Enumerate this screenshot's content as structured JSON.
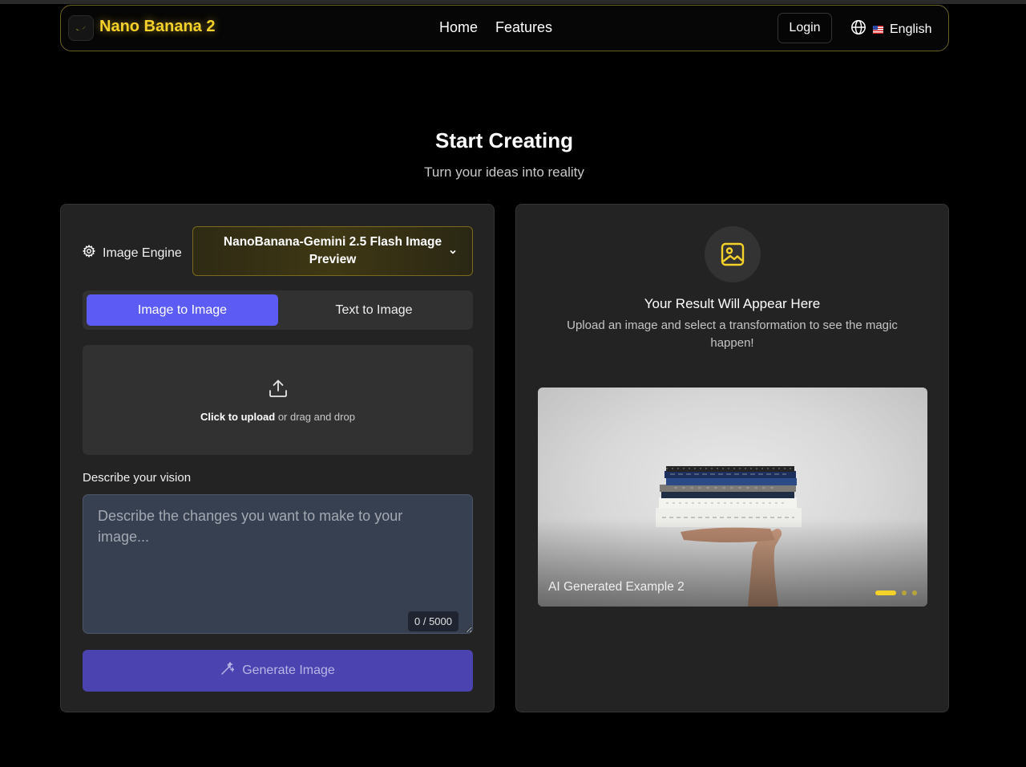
{
  "nav": {
    "brand": "Nano Banana 2",
    "links": [
      "Home",
      "Features"
    ],
    "login": "Login",
    "language": "English"
  },
  "hero": {
    "title": "Start Creating",
    "subtitle": "Turn your ideas into reality"
  },
  "editor": {
    "engine_label": "Image Engine",
    "engine_value": "NanoBanana-Gemini 2.5 Flash Image Preview",
    "tabs": [
      "Image to Image",
      "Text to Image"
    ],
    "active_tab": "Image to Image",
    "upload_strong": "Click to upload",
    "upload_rest": "or drag and drop",
    "vision_label": "Describe your vision",
    "vision_placeholder": "Describe the changes you want to make to your image...",
    "vision_value": "",
    "counter": "0 / 5000",
    "generate": "Generate Image"
  },
  "result": {
    "title": "Your Result Will Appear Here",
    "description": "Upload an image and select a transformation to see the magic happen!",
    "carousel_caption": "AI Generated Example 2",
    "carousel_slides": 3,
    "carousel_active": 1
  },
  "colors": {
    "brand_yellow": "#f5d22a",
    "accent_purple": "#5c5cf5",
    "generate_purple": "#4b44b0",
    "panel_bg": "#232323"
  },
  "icons": {
    "logo": "banana-icon",
    "language": "globe-icon",
    "flag": "us-flag-icon",
    "engine": "gear-icon",
    "dropdown": "chevron-down-icon",
    "upload": "upload-icon",
    "generate": "magic-wand-icon",
    "result": "image-icon"
  }
}
